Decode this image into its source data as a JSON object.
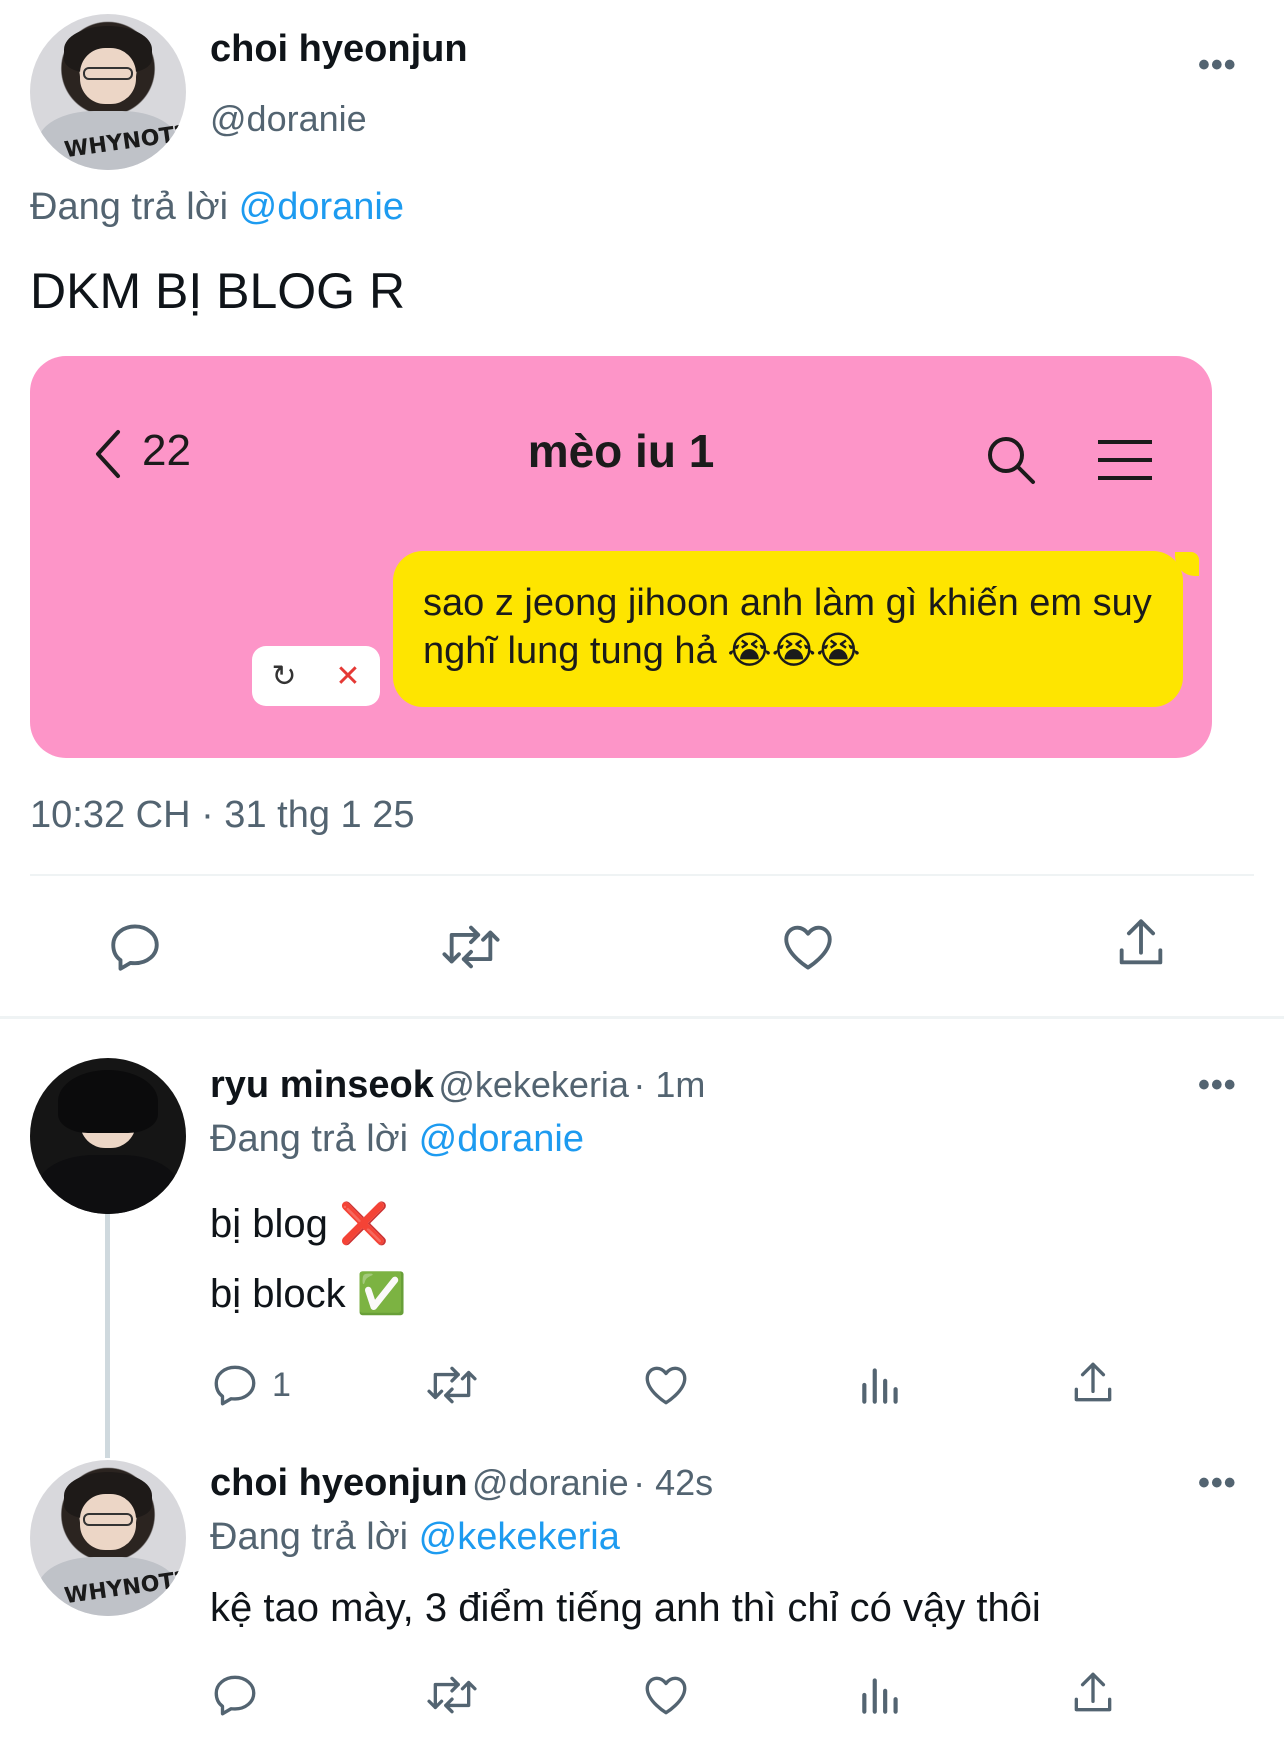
{
  "main_tweet": {
    "name": "choi hyeonjun",
    "handle": "@doranie",
    "reply_prefix": "Đang trả lời",
    "reply_to": "@doranie",
    "text": "DKM BỊ BLOG R",
    "timestamp": "10:32 CH · 31 thg 1 25",
    "more_label": "•••"
  },
  "embedded_screenshot": {
    "back_count": "22",
    "chat_title": "mèo iu 1",
    "message": "sao z jeong jihoon anh làm gì khiến em suy nghĩ lung tung hả 😭😭😭",
    "retry_glyph": "↻",
    "delete_glyph": "✕"
  },
  "replies": [
    {
      "name": "ryu minseok",
      "handle": "@kekekeria",
      "time": "· 1m",
      "reply_prefix": "Đang trả lời",
      "reply_to": "@doranie",
      "line1": "bị blog ❌",
      "line2": "bị block ✅",
      "reply_count": "1",
      "more_label": "•••"
    },
    {
      "name": "choi hyeonjun",
      "handle": "@doranie",
      "time": "· 42s",
      "reply_prefix": "Đang trả lời",
      "reply_to": "@kekekeria",
      "text": "kệ tao mày, 3 điểm tiếng anh thì chỉ có vậy thôi",
      "more_label": "•••"
    }
  ],
  "avatar_text": "WHYNOT?!",
  "icons": [
    "reply-icon",
    "retweet-icon",
    "like-icon",
    "share-icon",
    "views-icon",
    "search-icon",
    "menu-icon",
    "back-chevron-icon",
    "more-icon"
  ],
  "colors": {
    "link": "#1d9bf0",
    "secondary": "#536471",
    "card_bg": "#fd95c8",
    "bubble": "#fee500"
  }
}
